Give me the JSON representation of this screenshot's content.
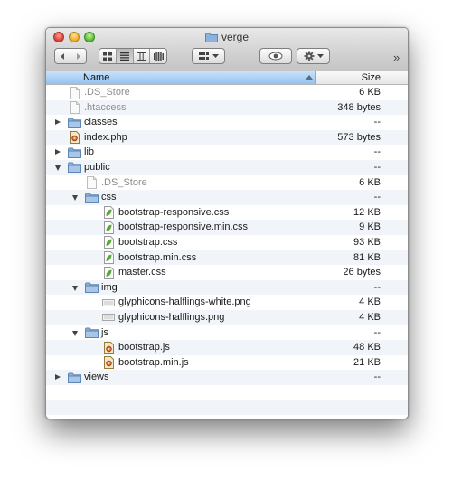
{
  "window": {
    "title": "verge"
  },
  "toolbar": {
    "back_icon": "back-arrow-icon",
    "forward_icon": "forward-arrow-icon",
    "view_modes": [
      "icon-view-icon",
      "list-view-icon",
      "column-view-icon",
      "coverflow-view-icon"
    ],
    "arrange_icon": "arrange-grid-icon",
    "quicklook_icon": "eye-icon",
    "action_icon": "gear-icon",
    "overflow": "»"
  },
  "columns": {
    "name": "Name",
    "size": "Size"
  },
  "colors": {
    "header_selected": "#93c2f0",
    "folder": "#8bb2dc",
    "alt_row": "#f1f5fa",
    "css_leaf": "#5aa83a",
    "php_badge": "#d9733a"
  },
  "files": [
    {
      "name": ".DS_Store",
      "size": "6 KB",
      "depth": 0,
      "kind": "generic",
      "disclosure": "none",
      "dim": true
    },
    {
      "name": ".htaccess",
      "size": "348 bytes",
      "depth": 0,
      "kind": "generic",
      "disclosure": "none",
      "dim": true
    },
    {
      "name": "classes",
      "size": "--",
      "depth": 0,
      "kind": "folder",
      "disclosure": "closed",
      "dim": false
    },
    {
      "name": "index.php",
      "size": "573 bytes",
      "depth": 0,
      "kind": "script",
      "disclosure": "none",
      "dim": false
    },
    {
      "name": "lib",
      "size": "--",
      "depth": 0,
      "kind": "folder",
      "disclosure": "closed",
      "dim": false
    },
    {
      "name": "public",
      "size": "--",
      "depth": 0,
      "kind": "folder",
      "disclosure": "open",
      "dim": false
    },
    {
      "name": ".DS_Store",
      "size": "6 KB",
      "depth": 1,
      "kind": "generic",
      "disclosure": "none",
      "dim": true
    },
    {
      "name": "css",
      "size": "--",
      "depth": 1,
      "kind": "folder",
      "disclosure": "open",
      "dim": false
    },
    {
      "name": "bootstrap-responsive.css",
      "size": "12 KB",
      "depth": 2,
      "kind": "css",
      "disclosure": "none",
      "dim": false
    },
    {
      "name": "bootstrap-responsive.min.css",
      "size": "9 KB",
      "depth": 2,
      "kind": "css",
      "disclosure": "none",
      "dim": false
    },
    {
      "name": "bootstrap.css",
      "size": "93 KB",
      "depth": 2,
      "kind": "css",
      "disclosure": "none",
      "dim": false
    },
    {
      "name": "bootstrap.min.css",
      "size": "81 KB",
      "depth": 2,
      "kind": "css",
      "disclosure": "none",
      "dim": false
    },
    {
      "name": "master.css",
      "size": "26 bytes",
      "depth": 2,
      "kind": "css",
      "disclosure": "none",
      "dim": false
    },
    {
      "name": "img",
      "size": "--",
      "depth": 1,
      "kind": "folder",
      "disclosure": "open",
      "dim": false
    },
    {
      "name": "glyphicons-halflings-white.png",
      "size": "4 KB",
      "depth": 2,
      "kind": "image",
      "disclosure": "none",
      "dim": false
    },
    {
      "name": "glyphicons-halflings.png",
      "size": "4 KB",
      "depth": 2,
      "kind": "image",
      "disclosure": "none",
      "dim": false
    },
    {
      "name": "js",
      "size": "--",
      "depth": 1,
      "kind": "folder",
      "disclosure": "open",
      "dim": false
    },
    {
      "name": "bootstrap.js",
      "size": "48 KB",
      "depth": 2,
      "kind": "script",
      "disclosure": "none",
      "dim": false
    },
    {
      "name": "bootstrap.min.js",
      "size": "21 KB",
      "depth": 2,
      "kind": "script",
      "disclosure": "none",
      "dim": false
    },
    {
      "name": "views",
      "size": "--",
      "depth": 0,
      "kind": "folder",
      "disclosure": "closed",
      "dim": false
    }
  ],
  "empty_rows": 3
}
